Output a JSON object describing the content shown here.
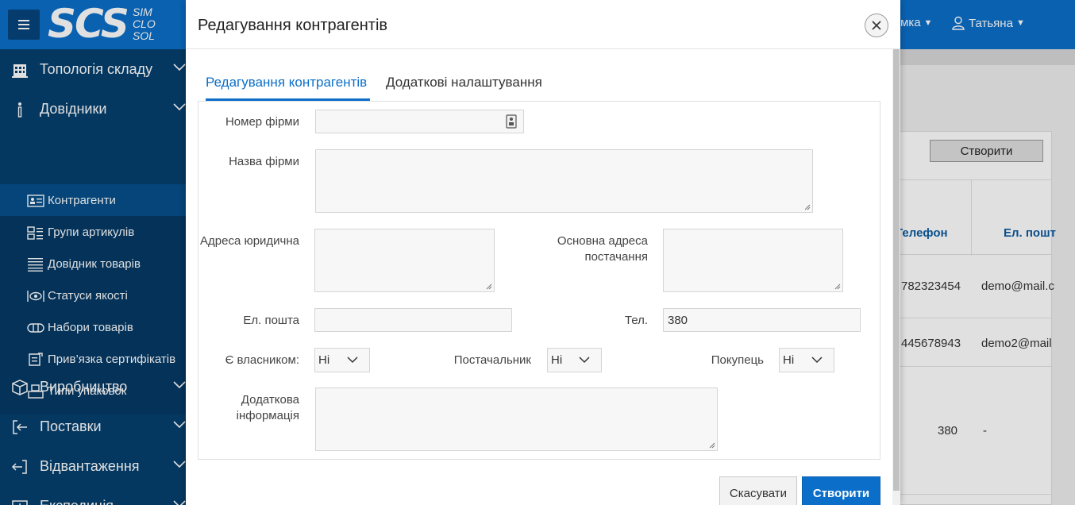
{
  "header": {
    "logo_text": "SCS",
    "logo_sub": [
      "SIM",
      "CLO",
      "SOL"
    ],
    "menu_item_partial": "мка",
    "user_name": "Татьяна"
  },
  "sidebar": {
    "sections": [
      {
        "label": "Топологія складу",
        "icon": "warehouse-icon"
      },
      {
        "label": "Довідники",
        "icon": "info-icon"
      },
      {
        "label": "Виробництво",
        "icon": "box-icon"
      },
      {
        "label": "Поставки",
        "icon": "sign-in-icon"
      },
      {
        "label": "Відвантаження",
        "icon": "sign-out-icon"
      },
      {
        "label": "Експедиція",
        "icon": "expedition-icon"
      }
    ],
    "sub_items": [
      {
        "label": "Контрагенти",
        "icon": "id-card-icon",
        "active": true
      },
      {
        "label": "Групи артикулів",
        "icon": "groups-icon"
      },
      {
        "label": "Довідник товарів",
        "icon": "list-icon"
      },
      {
        "label": "Статуси якості",
        "icon": "eye-icon"
      },
      {
        "label": "Набори товарів",
        "icon": "pill-icon"
      },
      {
        "label": "Прив’язка сертифікатів",
        "icon": "certificate-icon"
      },
      {
        "label": "Типи упаковок",
        "icon": "package-icon"
      }
    ]
  },
  "background": {
    "create_button": "Створити",
    "columns": [
      "Телефон",
      "Ел. пошт"
    ],
    "rows": [
      {
        "phone": "782323454",
        "email": "demo@mail.c"
      },
      {
        "phone": "445678943",
        "email": "demo2@mail"
      },
      {
        "phone": "380",
        "email": "-"
      }
    ]
  },
  "dialog": {
    "title": "Редагування контрагентів",
    "close_icon": "close-icon",
    "tabs": [
      {
        "label": "Редагування контрагентів",
        "active": true
      },
      {
        "label": "Додаткові налаштування",
        "active": false
      }
    ],
    "fields": {
      "firm_number": {
        "label": "Номер фірми",
        "value": ""
      },
      "firm_name": {
        "label": "Назва фірми",
        "value": ""
      },
      "legal_address": {
        "label": "Адреса юридична",
        "value": ""
      },
      "supply_address": {
        "label": "Основна адреса постачання",
        "value": ""
      },
      "email": {
        "label": "Ел. пошта",
        "value": ""
      },
      "phone": {
        "label": "Тел.",
        "value": "380"
      },
      "is_owner": {
        "label": "Є власником:",
        "value": "Ні"
      },
      "supplier": {
        "label": "Постачальник",
        "value": "Ні"
      },
      "buyer": {
        "label": "Покупець",
        "value": "Ні"
      },
      "additional_info": {
        "label": "Додаткова інформація",
        "value": ""
      }
    },
    "buttons": {
      "cancel": "Скасувати",
      "create": "Створити"
    }
  },
  "colors": {
    "primary": "#0b6fc9",
    "sidebar": "#05406f",
    "sidebar_sub": "#053a66",
    "sidebar_active": "#064f8a"
  }
}
